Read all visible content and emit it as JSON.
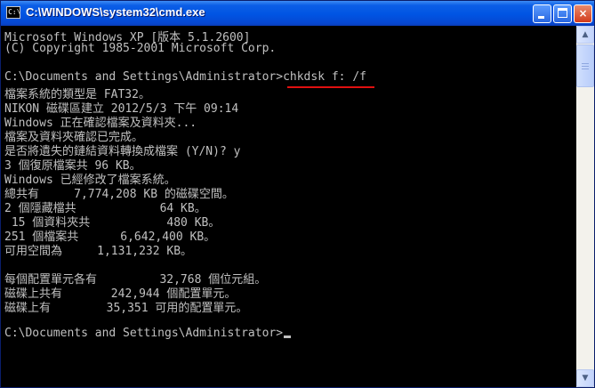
{
  "window": {
    "title": "C:\\WINDOWS\\system32\\cmd.exe",
    "icon": "cmd-icon",
    "icon_glyph": "C:\\",
    "minimize_label": "",
    "maximize_label": "",
    "close_label": "×"
  },
  "console": {
    "lines": [
      "Microsoft Windows XP [版本 5.1.2600]",
      "(C) Copyright 1985-2001 Microsoft Corp.",
      "",
      "C:\\Documents and Settings\\Administrator>chkdsk f: /f",
      "檔案系統的類型是 FAT32。",
      "NIKON 磁碟區建立 2012/5/3 下午 09:14",
      "Windows 正在確認檔案及資料夾...",
      "檔案及資料夾確認已完成。",
      "是否將遺失的鏈結資料轉換成檔案 (Y/N)? y",
      "3 個復原檔案共 96 KB。",
      "Windows 已經修改了檔案系統。",
      "總共有     7,774,208 KB 的磁碟空間。",
      "2 個隱藏檔共            64 KB。",
      " 15 個資料夾共           480 KB。",
      "251 個檔案共      6,642,400 KB。",
      "可用空間為     1,131,232 KB。",
      "",
      "每個配置單元各有         32,768 個位元組。",
      "磁碟上共有       242,944 個配置單元。",
      "磁碟上有        35,351 可用的配置單元。",
      "",
      "C:\\Documents and Settings\\Administrator>"
    ],
    "highlight_color": "#e01010",
    "text_color": "#c0c0c0",
    "background_color": "#000000"
  },
  "scrollbar": {
    "up_label": "▲",
    "down_label": "▼"
  }
}
